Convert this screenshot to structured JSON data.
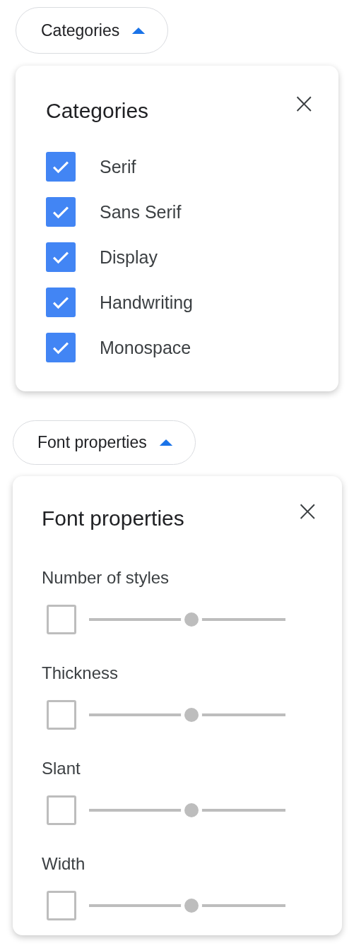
{
  "sections": [
    {
      "kind": "checklist",
      "chip": {
        "label": "Categories",
        "expanded": true
      },
      "panel": {
        "title": "Categories",
        "close": "×",
        "items": [
          {
            "label": "Serif",
            "checked": true
          },
          {
            "label": "Sans Serif",
            "checked": true
          },
          {
            "label": "Display",
            "checked": true
          },
          {
            "label": "Handwriting",
            "checked": true
          },
          {
            "label": "Monospace",
            "checked": true
          }
        ]
      }
    },
    {
      "kind": "sliders",
      "chip": {
        "label": "Font properties",
        "expanded": true
      },
      "panel": {
        "title": "Font properties",
        "close": "×",
        "items": [
          {
            "label": "Number of styles",
            "checked": false,
            "disabled": true,
            "level": 0.52
          },
          {
            "label": "Thickness",
            "checked": false,
            "disabled": true,
            "level": 0.52
          },
          {
            "label": "Slant",
            "checked": false,
            "disabled": true,
            "level": 0.52
          },
          {
            "label": "Width",
            "checked": false,
            "disabled": true,
            "level": 0.52
          }
        ]
      }
    }
  ]
}
